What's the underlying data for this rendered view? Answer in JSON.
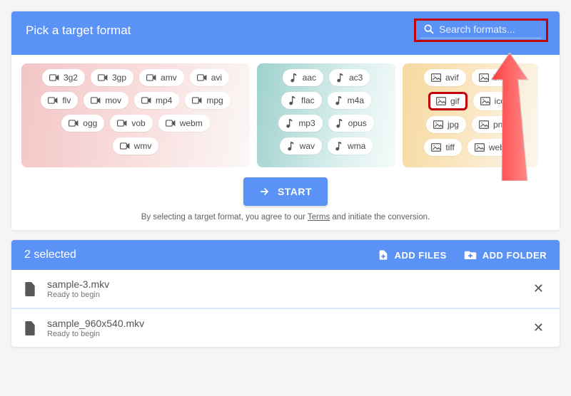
{
  "header": {
    "title": "Pick a target format",
    "search_placeholder": "Search formats..."
  },
  "formats": {
    "video": [
      "3g2",
      "3gp",
      "amv",
      "avi",
      "flv",
      "mov",
      "mp4",
      "mpg",
      "ogg",
      "vob",
      "webm",
      "wmv"
    ],
    "audio": [
      "aac",
      "ac3",
      "flac",
      "m4a",
      "mp3",
      "opus",
      "wav",
      "wma"
    ],
    "image": [
      "avif",
      "bmp",
      "gif",
      "ico",
      "jpg",
      "png",
      "tiff",
      "webp"
    ]
  },
  "highlight_format": "gif",
  "start_label": "START",
  "terms_prefix": "By selecting a target format, you agree to our ",
  "terms_link": "Terms",
  "terms_suffix": " and initiate the conversion.",
  "selection": {
    "count_label": "2 selected",
    "add_files": "ADD FILES",
    "add_folder": "ADD FOLDER"
  },
  "files": [
    {
      "name": "sample-3.mkv",
      "status": "Ready to begin"
    },
    {
      "name": "sample_960x540.mkv",
      "status": "Ready to begin"
    }
  ],
  "colors": {
    "accent": "#5b92f5",
    "highlight_border": "#c2000b"
  }
}
